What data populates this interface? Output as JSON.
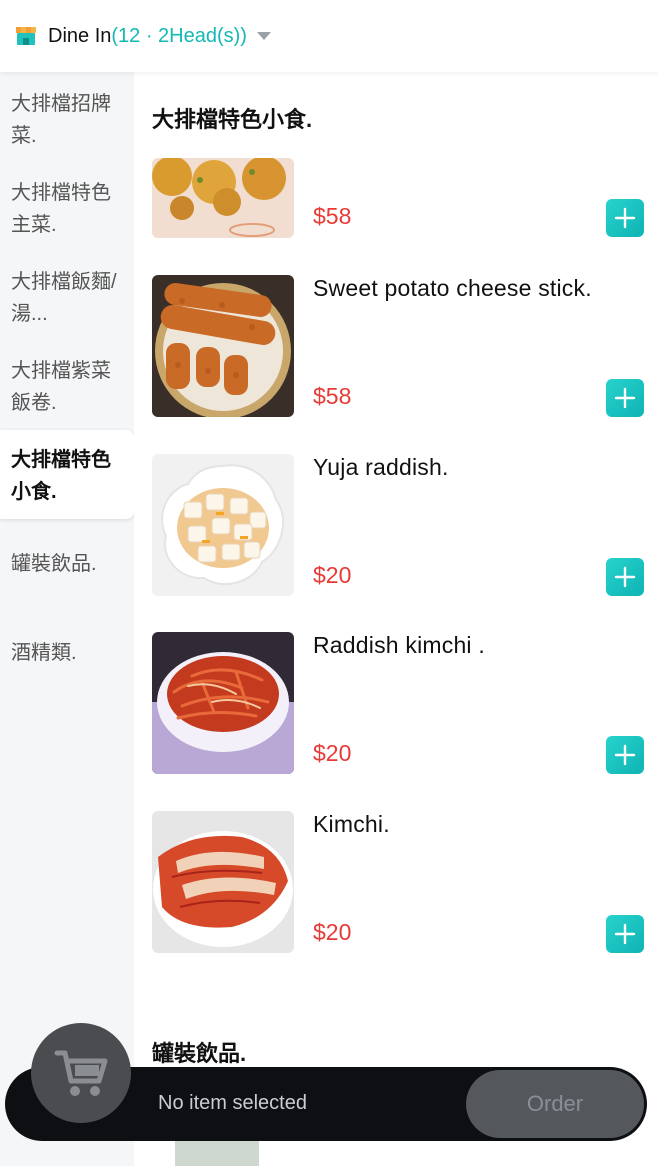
{
  "header": {
    "icon": "store-icon",
    "mode_label": "Dine In",
    "mode_detail": "(12 · 2Head(s))"
  },
  "sidebar": {
    "items": [
      {
        "label": "大排檔招牌菜."
      },
      {
        "label": "大排檔特色主菜."
      },
      {
        "label": "大排檔飯麵/湯..."
      },
      {
        "label": "大排檔紫菜飯卷."
      },
      {
        "label": "大排檔特色小食."
      },
      {
        "label": "罐裝飲品."
      },
      {
        "label": "酒精類."
      }
    ],
    "active_index": 4
  },
  "main": {
    "section_title": "大排檔特色小食.",
    "next_section_title": "罐裝飲品.",
    "items": [
      {
        "name": "",
        "price": "$58",
        "image": "fried-fritters-photo"
      },
      {
        "name": "Sweet potato cheese stick.",
        "price": "$58",
        "image": "cheese-sticks-photo"
      },
      {
        "name": "Yuja raddish.",
        "price": "$20",
        "image": "yuja-radish-photo"
      },
      {
        "name": "Raddish kimchi .",
        "price": "$20",
        "image": "radish-kimchi-photo"
      },
      {
        "name": "Kimchi.",
        "price": "$20",
        "image": "kimchi-photo"
      }
    ]
  },
  "cart": {
    "status": "No item selected",
    "order_label": "Order",
    "icon": "cart-icon"
  },
  "colors": {
    "accent": "#14b8b4",
    "price": "#e83a35",
    "bar": "#0e0f12"
  }
}
